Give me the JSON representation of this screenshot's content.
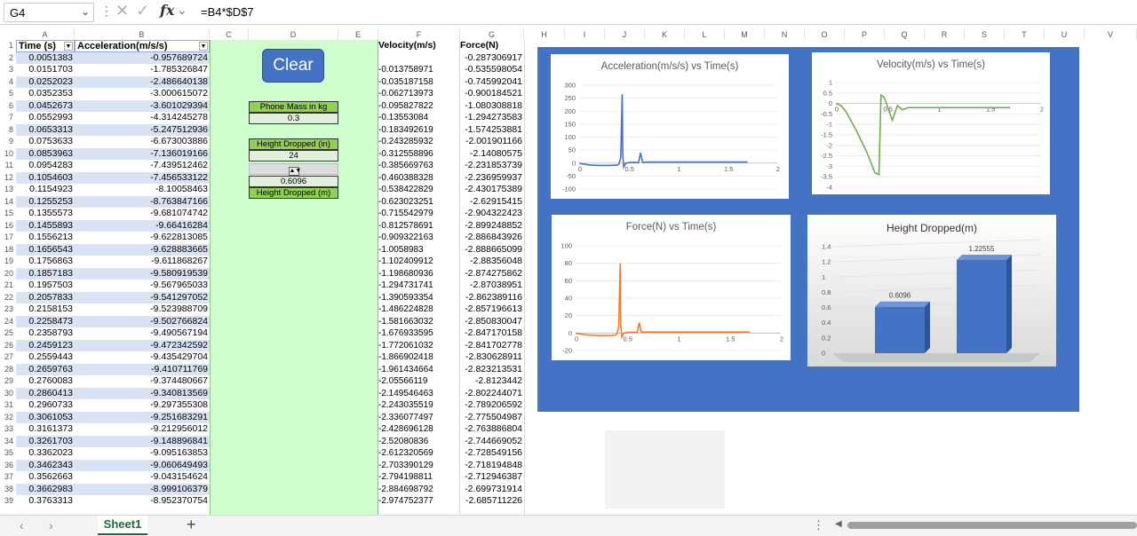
{
  "formula_bar": {
    "name_box": "G4",
    "formula": "=B4*$D$7"
  },
  "columns": [
    "A",
    "B",
    "C",
    "D",
    "E",
    "F",
    "G",
    "H",
    "I",
    "J",
    "K",
    "L",
    "M",
    "N",
    "O",
    "P",
    "Q",
    "R",
    "S",
    "T",
    "U",
    "V"
  ],
  "table_headers": {
    "time": "Time (s)",
    "acceleration": "Acceleration(m/s/s)",
    "velocity": "Velocity(m/s)",
    "force": "Force(N)"
  },
  "rows": [
    {
      "r": "2",
      "a": "0.0051383",
      "b": "-0.957689724",
      "f": "",
      "g": "-0.287306917"
    },
    {
      "r": "3",
      "a": "0.0151703",
      "b": "-1.785326847",
      "f": "-0.013758971",
      "g": "-0.535598054"
    },
    {
      "r": "4",
      "a": "0.0252023",
      "b": "-2.486640138",
      "f": "-0.035187158",
      "g": "-0.745992041"
    },
    {
      "r": "5",
      "a": "0.0352353",
      "b": "-3.000615072",
      "f": "-0.062713973",
      "g": "-0.900184521"
    },
    {
      "r": "6",
      "a": "0.0452673",
      "b": "-3.601029394",
      "f": "-0.095827822",
      "g": "-1.080308818"
    },
    {
      "r": "7",
      "a": "0.0552993",
      "b": "-4.314245278",
      "f": "-0.13553084",
      "g": "-1.294273583"
    },
    {
      "r": "8",
      "a": "0.0653313",
      "b": "-5.247512936",
      "f": "-0.183492619",
      "g": "-1.574253881"
    },
    {
      "r": "9",
      "a": "0.0753633",
      "b": "-6.673003886",
      "f": "-0.243285932",
      "g": "-2.001901166"
    },
    {
      "r": "10",
      "a": "0.0853963",
      "b": "-7.136019166",
      "f": "-0.312558896",
      "g": "-2.14080575"
    },
    {
      "r": "11",
      "a": "0.0954283",
      "b": "-7.439512462",
      "f": "-0.385669763",
      "g": "-2.231853739"
    },
    {
      "r": "12",
      "a": "0.1054603",
      "b": "-7.456533122",
      "f": "-0.460388328",
      "g": "-2.236959937"
    },
    {
      "r": "13",
      "a": "0.1154923",
      "b": "-8.10058463",
      "f": "-0.538422829",
      "g": "-2.430175389"
    },
    {
      "r": "14",
      "a": "0.1255253",
      "b": "-8.763847166",
      "f": "-0.623023251",
      "g": "-2.62915415"
    },
    {
      "r": "15",
      "a": "0.1355573",
      "b": "-9.681074742",
      "f": "-0.715542979",
      "g": "-2.904322423"
    },
    {
      "r": "16",
      "a": "0.1455893",
      "b": "-9.66416284",
      "f": "-0.812578691",
      "g": "-2.899248852"
    },
    {
      "r": "17",
      "a": "0.1556213",
      "b": "-9.622813085",
      "f": "-0.909322163",
      "g": "-2.886843926"
    },
    {
      "r": "18",
      "a": "0.1656543",
      "b": "-9.628883665",
      "f": "-1.0058983",
      "g": "-2.888665099"
    },
    {
      "r": "19",
      "a": "0.1756863",
      "b": "-9.611868267",
      "f": "-1.102409912",
      "g": "-2.88356048"
    },
    {
      "r": "20",
      "a": "0.1857183",
      "b": "-9.580919539",
      "f": "-1.198680936",
      "g": "-2.874275862"
    },
    {
      "r": "21",
      "a": "0.1957503",
      "b": "-9.567965033",
      "f": "-1.294731741",
      "g": "-2.87038951"
    },
    {
      "r": "22",
      "a": "0.2057833",
      "b": "-9.541297052",
      "f": "-1.390593354",
      "g": "-2.862389116"
    },
    {
      "r": "23",
      "a": "0.2158153",
      "b": "-9.523988709",
      "f": "-1.486224828",
      "g": "-2.857196613"
    },
    {
      "r": "24",
      "a": "0.2258473",
      "b": "-9.502766824",
      "f": "-1.581663032",
      "g": "-2.850830047"
    },
    {
      "r": "25",
      "a": "0.2358793",
      "b": "-9.490567194",
      "f": "-1.676933595",
      "g": "-2.847170158"
    },
    {
      "r": "26",
      "a": "0.2459123",
      "b": "-9.472342592",
      "f": "-1.772061032",
      "g": "-2.841702778"
    },
    {
      "r": "27",
      "a": "0.2559443",
      "b": "-9.435429704",
      "f": "-1.866902418",
      "g": "-2.830628911"
    },
    {
      "r": "28",
      "a": "0.2659763",
      "b": "-9.410711769",
      "f": "-1.961434664",
      "g": "-2.823213531"
    },
    {
      "r": "29",
      "a": "0.2760083",
      "b": "-9.374480667",
      "f": "-2.05566119",
      "g": "-2.8123442"
    },
    {
      "r": "30",
      "a": "0.2860413",
      "b": "-9.340813569",
      "f": "-2.149546463",
      "g": "-2.802244071"
    },
    {
      "r": "31",
      "a": "0.2960733",
      "b": "-9.297355308",
      "f": "-2.243035519",
      "g": "-2.789206592"
    },
    {
      "r": "32",
      "a": "0.3061053",
      "b": "-9.251683291",
      "f": "-2.336077497",
      "g": "-2.775504987"
    },
    {
      "r": "33",
      "a": "0.3161373",
      "b": "-9.212956012",
      "f": "-2.428696128",
      "g": "-2.763886804"
    },
    {
      "r": "34",
      "a": "0.3261703",
      "b": "-9.148896841",
      "f": "-2.52080836",
      "g": "-2.744669052"
    },
    {
      "r": "35",
      "a": "0.3362023",
      "b": "-9.095163853",
      "f": "-2.612320569",
      "g": "-2.728549156"
    },
    {
      "r": "36",
      "a": "0.3462343",
      "b": "-9.060649493",
      "f": "-2.703390129",
      "g": "-2.718194848"
    },
    {
      "r": "37",
      "a": "0.3562663",
      "b": "-9.043154624",
      "f": "-2.794198811",
      "g": "-2.712946387"
    },
    {
      "r": "38",
      "a": "0.3662983",
      "b": "-8.999106379",
      "f": "-2.884698792",
      "g": "-2.699731914"
    },
    {
      "r": "39",
      "a": "0.3763313",
      "b": "-8.952370754",
      "f": "-2.974752377",
      "g": "-2.685711226"
    }
  ],
  "controls": {
    "clear_label": "Clear",
    "phone_mass_label": "Phone Mass in kg",
    "phone_mass_value": "0.3",
    "height_in_label": "Height Dropped (in)",
    "height_in_value": "24",
    "height_m_value": "0.6096",
    "height_m_label": "Height Dropped (m)"
  },
  "chart_data": [
    {
      "type": "line",
      "title": "Acceleration(m/s/s) vs Time(s)",
      "color": "#4472c4",
      "ylim": [
        -100,
        300
      ],
      "xlim": [
        0,
        2
      ],
      "yticks": [
        "300",
        "250",
        "200",
        "150",
        "100",
        "50",
        "0",
        "-50",
        "-100"
      ],
      "xticks": [
        "0",
        "0.5",
        "1",
        "1.5",
        "2"
      ],
      "x": [
        0.0,
        0.1,
        0.2,
        0.3,
        0.38,
        0.4,
        0.42,
        0.435,
        0.44,
        0.45,
        0.47,
        0.5,
        0.55,
        0.6,
        0.62,
        0.64,
        0.7,
        0.8,
        1.0,
        1.2,
        1.5,
        1.7
      ],
      "y": [
        -1,
        -7,
        -9,
        -9,
        -8,
        -5,
        20,
        265,
        30,
        -15,
        0,
        2,
        3,
        2,
        40,
        3,
        4,
        4,
        4,
        4,
        4,
        4
      ]
    },
    {
      "type": "line",
      "title": "Velocity(m/s) vs Time(s)",
      "color": "#70ad47",
      "ylim": [
        -4,
        1
      ],
      "xlim": [
        0,
        2
      ],
      "yticks": [
        "1",
        "0.5",
        "0",
        "-0.5",
        "-1",
        "-1.5",
        "-2",
        "-2.5",
        "-3",
        "-3.5",
        "-4"
      ],
      "xticks": [
        "0",
        "0.5",
        "1",
        "1.5",
        "2"
      ],
      "x": [
        0.0,
        0.05,
        0.1,
        0.2,
        0.3,
        0.38,
        0.42,
        0.44,
        0.47,
        0.5,
        0.55,
        0.6,
        0.65,
        0.7,
        0.8,
        1.0,
        1.2,
        1.5,
        1.7
      ],
      "y": [
        0,
        -0.1,
        -0.4,
        -1.3,
        -2.3,
        -3.3,
        -3.4,
        0.4,
        0.3,
        -0.1,
        -0.8,
        -0.1,
        -0.3,
        -0.2,
        -0.2,
        -0.2,
        -0.2,
        -0.2,
        -0.2
      ]
    },
    {
      "type": "line",
      "title": "Force(N) vs Time(s)",
      "color": "#ed7d31",
      "ylim": [
        -20,
        100
      ],
      "xlim": [
        0,
        2
      ],
      "yticks": [
        "100",
        "80",
        "60",
        "40",
        "20",
        "0",
        "-20"
      ],
      "xticks": [
        "0",
        "0.5",
        "1",
        "1.5",
        "2"
      ],
      "x": [
        0.0,
        0.1,
        0.2,
        0.3,
        0.38,
        0.4,
        0.42,
        0.435,
        0.44,
        0.45,
        0.47,
        0.5,
        0.55,
        0.6,
        0.62,
        0.64,
        0.7,
        0.8,
        1.0,
        1.2,
        1.5,
        1.7
      ],
      "y": [
        -0.3,
        -2,
        -2.8,
        -2.8,
        -2.5,
        -1.5,
        6,
        80,
        9,
        -4.5,
        0,
        0.6,
        1,
        0.6,
        12,
        1,
        1.2,
        1.2,
        1.2,
        1.2,
        1.2,
        1.2
      ]
    },
    {
      "type": "bar",
      "title": "Height Dropped(m)",
      "color": "#4472c4",
      "ylim": [
        0,
        1.4
      ],
      "yticks": [
        "1.4",
        "1.2",
        "1",
        "0.8",
        "0.6",
        "0.4",
        "0.2",
        "0"
      ],
      "values": [
        0.6096,
        1.22555
      ],
      "labels": [
        "0.6096",
        "1.22555"
      ]
    }
  ]
}
